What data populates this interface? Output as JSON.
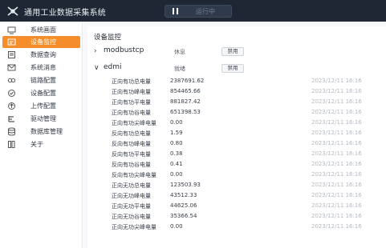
{
  "app": {
    "title": "通用工业数据采集系统",
    "run_status": "运行中"
  },
  "sidebar": {
    "items": [
      {
        "label": "系统画面",
        "icon": "monitor-icon",
        "active": false
      },
      {
        "label": "设备监控",
        "icon": "device-monitor-icon",
        "active": true
      },
      {
        "label": "数据查询",
        "icon": "data-query-icon",
        "active": false
      },
      {
        "label": "系统消息",
        "icon": "message-icon",
        "active": false
      },
      {
        "label": "链路配置",
        "icon": "link-icon",
        "active": false
      },
      {
        "label": "设备配置",
        "icon": "device-config-icon",
        "active": false
      },
      {
        "label": "上传配置",
        "icon": "upload-icon",
        "active": false
      },
      {
        "label": "驱动管理",
        "icon": "driver-icon",
        "active": false
      },
      {
        "label": "数据库管理",
        "icon": "database-icon",
        "active": false
      },
      {
        "label": "关于",
        "icon": "about-icon",
        "active": false
      }
    ]
  },
  "main": {
    "title": "设备监控",
    "devices": [
      {
        "name": "modbustcp",
        "status": "休息",
        "button": "禁用",
        "expanded": false
      },
      {
        "name": "edmi",
        "status": "就绪",
        "button": "禁用",
        "expanded": true
      }
    ],
    "measurements": [
      {
        "name": "正向有功总电量",
        "value": "2387691.62",
        "time": "2023/12/11 16:16"
      },
      {
        "name": "正向有功峰电量",
        "value": "854465.66",
        "time": "2023/12/11 16:16"
      },
      {
        "name": "正向有功平电量",
        "value": "881827.42",
        "time": "2023/12/11 16:16"
      },
      {
        "name": "正向有功谷电量",
        "value": "651398.53",
        "time": "2023/12/11 16:16"
      },
      {
        "name": "正向有功尖峰电量",
        "value": "0.00",
        "time": "2023/12/11 16:16"
      },
      {
        "name": "反向有功总电量",
        "value": "1.59",
        "time": "2023/12/11 16:16"
      },
      {
        "name": "反向有功峰电量",
        "value": "0.80",
        "time": "2023/12/11 16:16"
      },
      {
        "name": "反向有功平电量",
        "value": "0.38",
        "time": "2023/12/11 16:16"
      },
      {
        "name": "反向有功谷电量",
        "value": "0.41",
        "time": "2023/12/11 16:16"
      },
      {
        "name": "反向有功尖峰电量",
        "value": "0.00",
        "time": "2023/12/11 16:16"
      },
      {
        "name": "正向无功总电量",
        "value": "123503.93",
        "time": "2023/12/11 16:16"
      },
      {
        "name": "正向无功峰电量",
        "value": "43512.33",
        "time": "2023/12/11 16:16"
      },
      {
        "name": "正向无功平电量",
        "value": "44625.06",
        "time": "2023/12/11 16:16"
      },
      {
        "name": "正向无功谷电量",
        "value": "35366.54",
        "time": "2023/12/11 16:16"
      },
      {
        "name": "正向无功尖峰电量",
        "value": "0.00",
        "time": "2023/12/11 16:16"
      }
    ]
  },
  "colors": {
    "topbar": "#1e2733",
    "accent": "#f58e2a",
    "timestamp": "#b4bac2"
  }
}
